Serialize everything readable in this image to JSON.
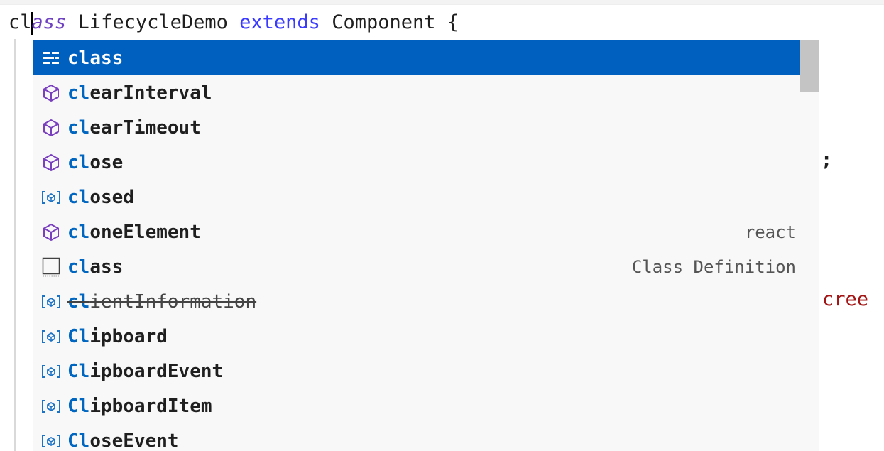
{
  "editor": {
    "code_line": {
      "typed": "cl",
      "ghost": "ass",
      "name": " LifecycleDemo ",
      "keyword": "extends",
      "rest": " Component {"
    },
    "background_fragments": {
      "semicolon": ";",
      "string_fragment": "cree"
    }
  },
  "suggestions": [
    {
      "icon": "keyword-snippet-icon",
      "match": "cl",
      "rest": "ass",
      "detail": "",
      "selected": true,
      "deprecated": false
    },
    {
      "icon": "method-cube-icon",
      "match": "cl",
      "rest": "earInterval",
      "detail": "",
      "selected": false,
      "deprecated": false
    },
    {
      "icon": "method-cube-icon",
      "match": "cl",
      "rest": "earTimeout",
      "detail": "",
      "selected": false,
      "deprecated": false
    },
    {
      "icon": "method-cube-icon",
      "match": "cl",
      "rest": "ose",
      "detail": "",
      "selected": false,
      "deprecated": false
    },
    {
      "icon": "variable-icon",
      "match": "cl",
      "rest": "osed",
      "detail": "",
      "selected": false,
      "deprecated": false
    },
    {
      "icon": "method-cube-icon",
      "match": "cl",
      "rest": "oneElement",
      "detail": "react",
      "selected": false,
      "deprecated": false
    },
    {
      "icon": "snippet-square-icon",
      "match": "cl",
      "rest": "ass",
      "detail": "Class Definition",
      "selected": false,
      "deprecated": false
    },
    {
      "icon": "variable-icon",
      "match": "cl",
      "rest": "ientInformation",
      "detail": "",
      "selected": false,
      "deprecated": true
    },
    {
      "icon": "variable-icon",
      "match": "Cl",
      "rest": "ipboard",
      "detail": "",
      "selected": false,
      "deprecated": false
    },
    {
      "icon": "variable-icon",
      "match": "Cl",
      "rest": "ipboardEvent",
      "detail": "",
      "selected": false,
      "deprecated": false
    },
    {
      "icon": "variable-icon",
      "match": "Cl",
      "rest": "ipboardItem",
      "detail": "",
      "selected": false,
      "deprecated": false
    },
    {
      "icon": "variable-icon",
      "match": "Cl",
      "rest": "oseEvent",
      "detail": "",
      "selected": false,
      "deprecated": false
    }
  ],
  "colors": {
    "selection": "#0060c0",
    "match_highlight": "#0066bf",
    "method_icon": "#7a3fbf",
    "variable_icon": "#1a73c7",
    "keyword": "#3b3bff"
  }
}
